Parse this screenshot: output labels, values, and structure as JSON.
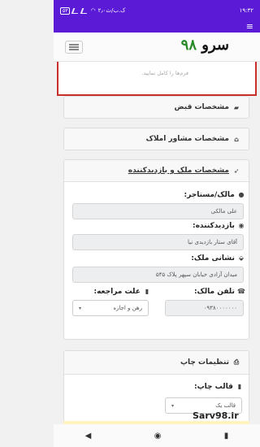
{
  "status_bar": {
    "time": "۱۹:۳۲",
    "network": "۲٫۰ک.ب/ث",
    "battery": "۵۳"
  },
  "header": {
    "logo_text": "سرو",
    "logo_number": "۹۸",
    "purple_menu_icon": "hamburger-icon"
  },
  "alert": {
    "text": "فرم‌ها را کامل نمایید."
  },
  "sections": {
    "receipt": {
      "title": "مشخصات قبض",
      "icon": "book-icon"
    },
    "consultant": {
      "title": "مشخصات مشاور املاک",
      "icon": "home-icon"
    },
    "property": {
      "title": "مشخصات ملک و بازدیدکننده",
      "icon": "rocket-icon"
    },
    "print": {
      "title": "تنظیمات چاپ",
      "icon": "print-icon"
    }
  },
  "form": {
    "owner_label": "مالک/مستاجر:",
    "owner_value": "علی مالکی",
    "visitor_label": "بازدیدکننده:",
    "visitor_value": "آقای ستار بازدیدی نیا",
    "address_label": "نشانی ملک:",
    "address_value": "میدان آزادی خیابان سپهر پلاک ۵۴۵",
    "reason_label": "علت مراجعه:",
    "reason_value": "رهن و اجاره",
    "phone_label": "تلفن مالک:",
    "phone_value": "۰۹۳۸۰۰۰۰۰۰۰",
    "template_label": "قالب چاپ:",
    "template_value": "قالب یک"
  },
  "watermark": "Sarv98.ir",
  "bottom_nav": {
    "back_glyph": "◀",
    "home_glyph": "◉",
    "recent_glyph": "▮"
  }
}
